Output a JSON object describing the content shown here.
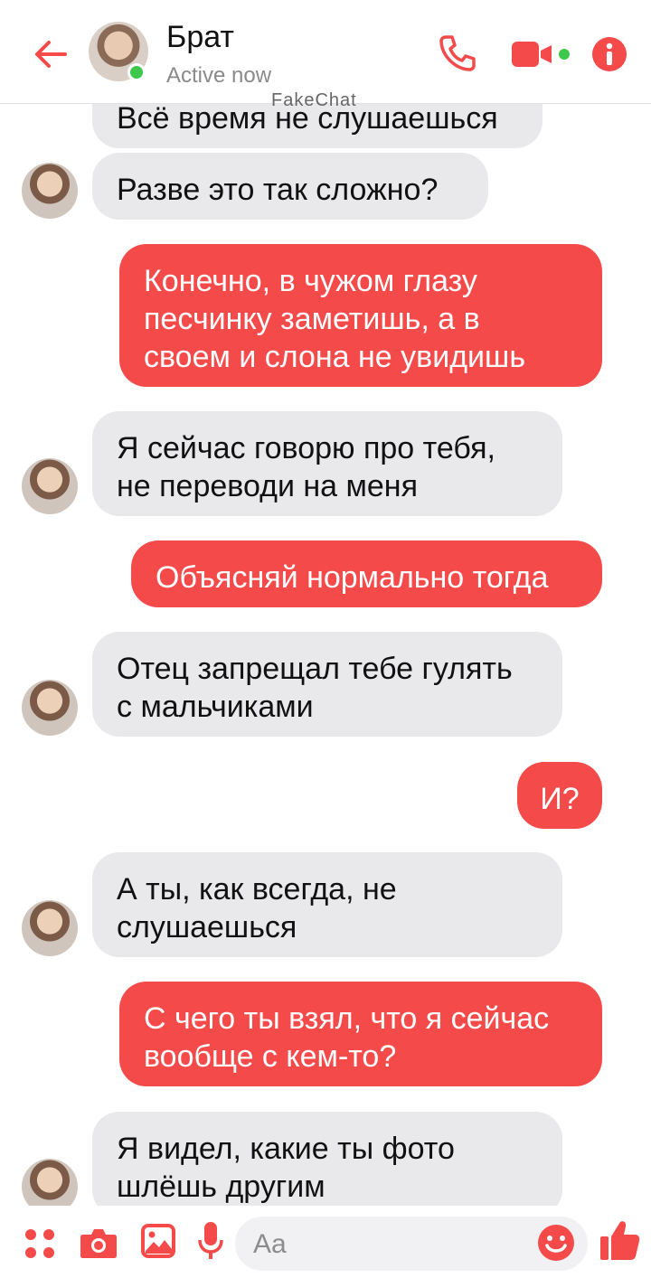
{
  "header": {
    "contact_name": "Брат",
    "status": "Active now",
    "watermark": "FakeChat"
  },
  "colors": {
    "accent": "#f44a4a",
    "incoming_bubble": "#e9e9ec",
    "online": "#3dc84b"
  },
  "messages": [
    {
      "direction": "in",
      "text": "Всё время не слушаешься"
    },
    {
      "direction": "in",
      "text": "Разве это так сложно?"
    },
    {
      "direction": "out",
      "text": "Конечно, в чужом глазу\nпесчинку заметишь, а в\nсвоем и слона не увидишь"
    },
    {
      "direction": "in",
      "text": "Я сейчас говорю про тебя,\nне переводи на меня"
    },
    {
      "direction": "out",
      "text": "Объясняй нормально тогда"
    },
    {
      "direction": "in",
      "text": "Отец запрещал тебе гулять\nс мальчиками"
    },
    {
      "direction": "out",
      "text": "И?"
    },
    {
      "direction": "in",
      "text": "А ты, как всегда, не\nслушаешься"
    },
    {
      "direction": "out",
      "text": "С чего ты взял, что я сейчас\nвообще с кем-то?"
    },
    {
      "direction": "in",
      "text": "Я видел, какие ты фото\nшлёшь другим"
    }
  ],
  "composer": {
    "placeholder": "Aa",
    "icons": [
      "apps-icon",
      "camera-icon",
      "gallery-icon",
      "microphone-icon",
      "emoji-icon",
      "thumbs-up-icon"
    ]
  }
}
